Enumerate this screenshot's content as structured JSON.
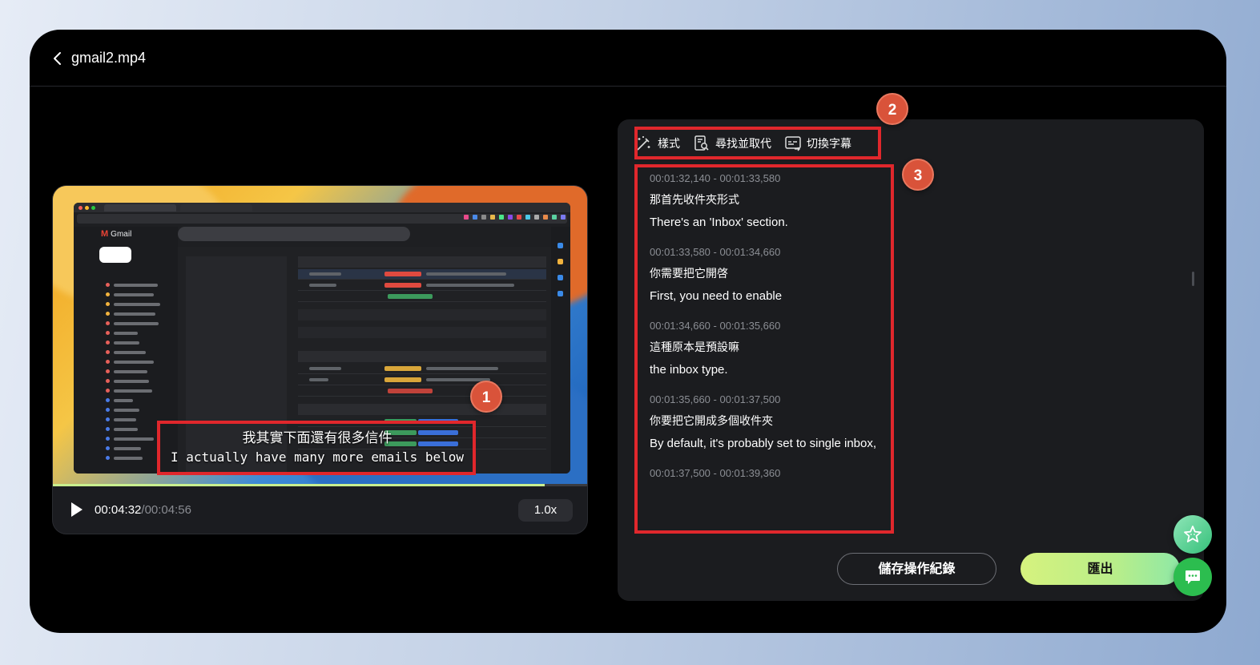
{
  "header": {
    "back_icon": "chevron-left-icon",
    "file_name": "gmail2.mp4"
  },
  "player": {
    "subtitle_zh": "我其實下面還有很多信件",
    "subtitle_en": "I actually have many more emails below",
    "current_time": "00:04:32",
    "separator": "/",
    "total_time": "00:04:56",
    "progress": 0.92,
    "speed": "1.0x",
    "play_icon": "play-icon"
  },
  "toolbar": {
    "style_label": "樣式",
    "style_icon": "magic-wand-icon",
    "find_replace_label": "尋找並取代",
    "find_replace_icon": "find-replace-icon",
    "switch_subtitle_label": "切換字幕",
    "switch_subtitle_icon": "subtitle-switch-icon"
  },
  "subtitles": [
    {
      "time": "00:01:32,140 - 00:01:33,580",
      "zh": "那首先收件夾形式",
      "en": "There's an 'Inbox' section."
    },
    {
      "time": "00:01:33,580 - 00:01:34,660",
      "zh": "你需要把它開啓",
      "en": "First, you need to enable"
    },
    {
      "time": "00:01:34,660 - 00:01:35,660",
      "zh": "這種原本是預設嘛",
      "en": "the inbox type."
    },
    {
      "time": "00:01:35,660 - 00:01:37,500",
      "zh": "你要把它開成多個收件夾",
      "en": "By default, it's probably set to single inbox,"
    },
    {
      "time": "00:01:37,500 - 00:01:39,360",
      "zh": "",
      "en": ""
    }
  ],
  "actions": {
    "save_label": "儲存操作紀錄",
    "export_label": "匯出"
  },
  "annotations": {
    "badge_1": "1",
    "badge_2": "2",
    "badge_3": "3",
    "color": "#e0272c",
    "badge_color": "#d9533a"
  },
  "floating": {
    "star_icon": "star-face-icon",
    "chat_icon": "chat-bubble-icon"
  },
  "colors": {
    "accent_green": "#c9ef8e",
    "panel_bg": "#1b1c1f",
    "window_bg": "#000000"
  }
}
